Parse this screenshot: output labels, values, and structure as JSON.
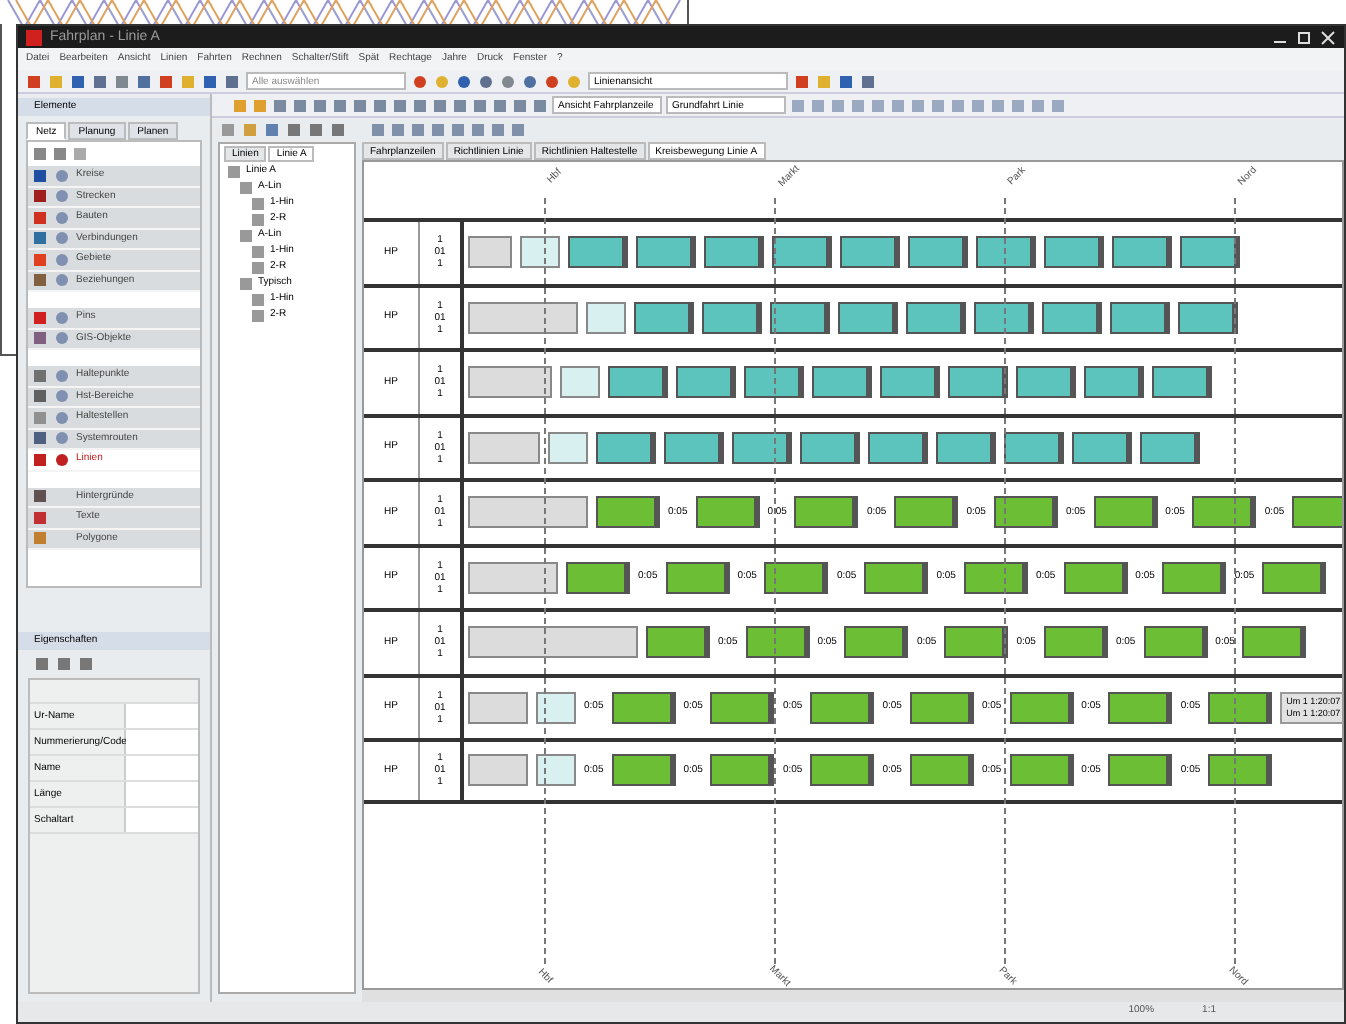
{
  "window": {
    "title": "Fahrplan - Linie A"
  },
  "menu": [
    "Datei",
    "Bearbeiten",
    "Ansicht",
    "Linien",
    "Fahrten",
    "Rechnen",
    "Schalter/Stift",
    "Spät",
    "Rechtage",
    "Jahre",
    "Druck",
    "Fenster",
    "?"
  ],
  "toolbar": {
    "search": {
      "placeholder": "Alle auswählen"
    },
    "combo": {
      "value": "Linienansicht"
    }
  },
  "toolbar2": {
    "combo": {
      "value": "Ansicht Fahrplanzeile"
    },
    "combo2": {
      "value": "Grundfahrt Linie"
    }
  },
  "elements": {
    "title": "Elemente",
    "tabs": [
      {
        "label": "Netz",
        "selected": true
      },
      {
        "label": "Planung",
        "selected": false
      },
      {
        "label": "Planen",
        "selected": false
      }
    ],
    "groups": [
      [
        {
          "label": "Kreise",
          "color": "#1f4fa0",
          "filter": true,
          "selected": false
        },
        {
          "label": "Strecken",
          "color": "#a02020",
          "filter": true,
          "selected": false
        },
        {
          "label": "Bauten",
          "color": "#d03020",
          "filter": true,
          "selected": false
        },
        {
          "label": "Verbindungen",
          "color": "#3070a0",
          "filter": true,
          "selected": false
        },
        {
          "label": "Gebiete",
          "color": "#e04020",
          "filter": true,
          "selected": false
        },
        {
          "label": "Beziehungen",
          "color": "#806040",
          "filter": true,
          "selected": false
        }
      ],
      [
        {
          "label": "Pins",
          "color": "#d02020",
          "filter": true,
          "selected": false
        },
        {
          "label": "GIS-Objekte",
          "color": "#806080",
          "filter": true,
          "selected": false
        }
      ],
      [
        {
          "label": "Haltepunkte",
          "color": "#707070",
          "filter": true,
          "selected": false
        },
        {
          "label": "Hst-Bereiche",
          "color": "#606060",
          "filter": true,
          "selected": false
        },
        {
          "label": "Haltestellen",
          "color": "#909090",
          "filter": true,
          "selected": false
        },
        {
          "label": "Systemrouten",
          "color": "#506080",
          "filter": true,
          "selected": false
        },
        {
          "label": "Linien",
          "color": "#c02020",
          "filter": true,
          "selected": true
        }
      ],
      [
        {
          "label": "Hintergründe",
          "color": "#605050",
          "filter": false,
          "selected": false
        },
        {
          "label": "Texte",
          "color": "#c03030",
          "filter": false,
          "selected": false
        },
        {
          "label": "Polygone",
          "color": "#c08030",
          "filter": false,
          "selected": false
        }
      ]
    ]
  },
  "properties": {
    "title": "Eigenschaften",
    "rows": [
      "Ur-Name",
      "Nummerierung/Code",
      "Name",
      "Länge",
      "Schaltart"
    ]
  },
  "tree": {
    "tabs": [
      {
        "label": "Linien",
        "selected": false
      },
      {
        "label": "Linie A",
        "selected": true
      }
    ],
    "items": [
      {
        "label": "Linie A",
        "children": [
          {
            "label": "A-Lin",
            "children": [
              {
                "label": "1-Hin"
              },
              {
                "label": "2-R"
              }
            ]
          },
          {
            "label": "A-Lin",
            "children": [
              {
                "label": "1-Hin"
              },
              {
                "label": "2-R"
              }
            ]
          },
          {
            "label": "Typisch",
            "children": [
              {
                "label": "1-Hin"
              },
              {
                "label": "2-R"
              }
            ]
          }
        ]
      }
    ]
  },
  "view_tabs": [
    {
      "label": "Fahrplanzeilen",
      "selected": false
    },
    {
      "label": "Richtlinien Linie",
      "selected": false
    },
    {
      "label": "Richtlinien Haltestelle",
      "selected": false
    },
    {
      "label": "Kreisbewegung Linie A",
      "selected": true
    }
  ],
  "stops_top": [
    "Hbf",
    "Markt",
    "Park",
    "Nord"
  ],
  "stops_bottom": [
    "Hbf",
    "Markt",
    "Park",
    "Nord"
  ],
  "rows": [
    {
      "label": "HP",
      "sub": [
        "1",
        "01",
        "1"
      ],
      "color": "#5cc3bd",
      "trips": [
        {
          "kind": "idle"
        },
        {
          "kind": "start"
        },
        {
          "kind": "trip"
        },
        {
          "kind": "trip"
        },
        {
          "kind": "trip"
        },
        {
          "kind": "trip"
        },
        {
          "kind": "trip"
        },
        {
          "kind": "trip"
        },
        {
          "kind": "trip"
        },
        {
          "kind": "trip"
        },
        {
          "kind": "trip"
        },
        {
          "kind": "trip"
        }
      ]
    },
    {
      "label": "HP",
      "sub": [
        "1",
        "01",
        "1"
      ],
      "color": "#5cc3bd",
      "trips": [
        {
          "kind": "idle"
        },
        {
          "kind": "start"
        },
        {
          "kind": "trip"
        },
        {
          "kind": "trip"
        },
        {
          "kind": "trip"
        },
        {
          "kind": "trip"
        },
        {
          "kind": "trip"
        },
        {
          "kind": "trip"
        },
        {
          "kind": "trip"
        },
        {
          "kind": "trip"
        },
        {
          "kind": "trip"
        }
      ]
    },
    {
      "label": "HP",
      "sub": [
        "1",
        "01",
        "1"
      ],
      "color": "#5cc3bd",
      "trips": [
        {
          "kind": "idle"
        },
        {
          "kind": "start"
        },
        {
          "kind": "trip"
        },
        {
          "kind": "trip"
        },
        {
          "kind": "trip"
        },
        {
          "kind": "trip"
        },
        {
          "kind": "trip"
        },
        {
          "kind": "trip"
        },
        {
          "kind": "trip"
        },
        {
          "kind": "trip"
        },
        {
          "kind": "trip"
        }
      ]
    },
    {
      "label": "HP",
      "sub": [
        "1",
        "01",
        "1"
      ],
      "color": "#5cc3bd",
      "trips": [
        {
          "kind": "idle"
        },
        {
          "kind": "start"
        },
        {
          "kind": "trip"
        },
        {
          "kind": "trip"
        },
        {
          "kind": "trip"
        },
        {
          "kind": "trip"
        },
        {
          "kind": "trip"
        },
        {
          "kind": "trip"
        },
        {
          "kind": "trip"
        },
        {
          "kind": "trip"
        },
        {
          "kind": "trip"
        }
      ]
    },
    {
      "label": "HP",
      "sub": [
        "1",
        "01",
        "1"
      ],
      "color": "#6cbf35",
      "trips": [
        {
          "kind": "idle"
        },
        {
          "kind": "trip"
        },
        {
          "kind": "trip",
          "gap": "0:05"
        },
        {
          "kind": "trip",
          "gap": "0:05"
        },
        {
          "kind": "trip",
          "gap": "0:05"
        },
        {
          "kind": "trip",
          "gap": "0:05"
        },
        {
          "kind": "trip",
          "gap": "0:05"
        },
        {
          "kind": "trip",
          "gap": "0:05"
        },
        {
          "kind": "trip",
          "gap": "0:05"
        }
      ]
    },
    {
      "label": "HP",
      "sub": [
        "1",
        "01",
        "1"
      ],
      "color": "#6cbf35",
      "trips": [
        {
          "kind": "idle"
        },
        {
          "kind": "trip"
        },
        {
          "kind": "trip",
          "gap": "0:05"
        },
        {
          "kind": "trip",
          "gap": "0:05"
        },
        {
          "kind": "trip",
          "gap": "0:05"
        },
        {
          "kind": "trip",
          "gap": "0:05"
        },
        {
          "kind": "trip",
          "gap": "0:05"
        },
        {
          "kind": "trip",
          "gap": "0:05"
        },
        {
          "kind": "trip",
          "gap": "0:05"
        }
      ]
    },
    {
      "label": "HP",
      "sub": [
        "1",
        "01",
        "1"
      ],
      "color": "#6cbf35",
      "trips": [
        {
          "kind": "idle"
        },
        {
          "kind": "trip"
        },
        {
          "kind": "trip",
          "gap": "0:05"
        },
        {
          "kind": "trip",
          "gap": "0:05"
        },
        {
          "kind": "trip",
          "gap": "0:05"
        },
        {
          "kind": "trip",
          "gap": "0:05"
        },
        {
          "kind": "trip",
          "gap": "0:05"
        },
        {
          "kind": "trip",
          "gap": "0:05"
        }
      ]
    },
    {
      "label": "HP",
      "sub": [
        "1",
        "01",
        "1"
      ],
      "color": "#6cbf35",
      "trips": [
        {
          "kind": "idle"
        },
        {
          "kind": "start"
        },
        {
          "kind": "trip",
          "gap": "0:05"
        },
        {
          "kind": "trip",
          "gap": "0:05"
        },
        {
          "kind": "trip",
          "gap": "0:05"
        },
        {
          "kind": "trip",
          "gap": "0:05"
        },
        {
          "kind": "trip",
          "gap": "0:05"
        },
        {
          "kind": "trip",
          "gap": "0:05"
        },
        {
          "kind": "trip",
          "gap": "0:05"
        },
        {
          "kind": "note",
          "lines": [
            "Um 1 1:20:07",
            "Um 1 1:20:07"
          ]
        }
      ]
    },
    {
      "label": "HP",
      "sub": [
        "1",
        "01",
        "1"
      ],
      "color": "#6cbf35",
      "trips": [
        {
          "kind": "idle"
        },
        {
          "kind": "start"
        },
        {
          "kind": "trip",
          "gap": "0:05"
        },
        {
          "kind": "trip",
          "gap": "0:05"
        },
        {
          "kind": "trip",
          "gap": "0:05"
        },
        {
          "kind": "trip",
          "gap": "0:05"
        },
        {
          "kind": "trip",
          "gap": "0:05"
        },
        {
          "kind": "trip",
          "gap": "0:05"
        },
        {
          "kind": "trip",
          "gap": "0:05"
        }
      ]
    }
  ],
  "status": [
    "100%",
    "1:1"
  ]
}
